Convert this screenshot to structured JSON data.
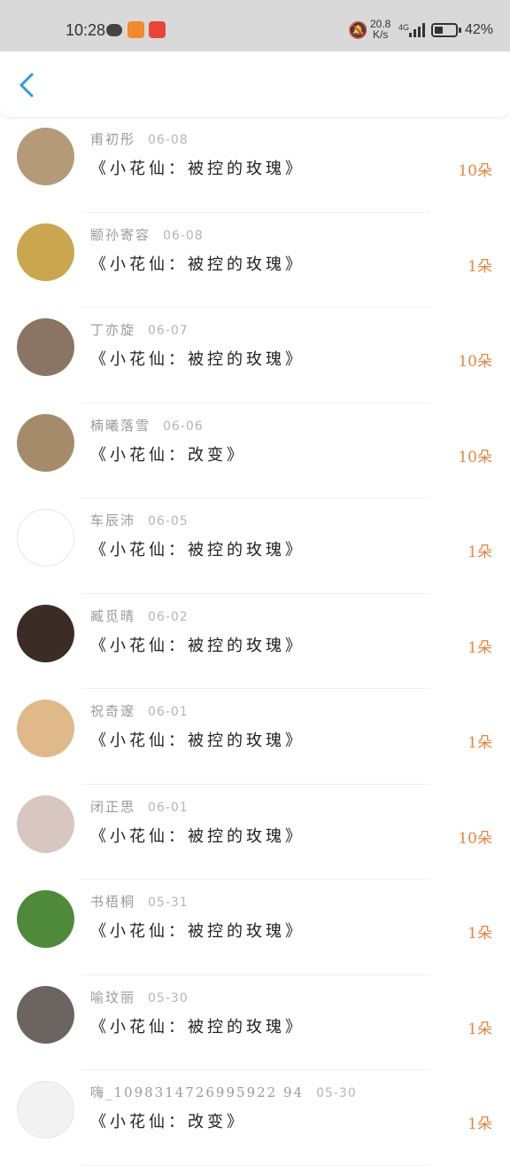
{
  "status_bar": {
    "time": "10:28",
    "speed_value": "20.8",
    "speed_unit": "K/s",
    "network": "4G",
    "battery_percent": "42%",
    "battery_level": 0.42
  },
  "header": {
    "back_icon": "chevron-left-icon",
    "accent_color": "#2b9be8"
  },
  "items": [
    {
      "name": "甫初彤",
      "date": "06-08",
      "title": "《小花仙：被控的玫瑰》",
      "count": "10朵",
      "avatar_color": "#b59a7a"
    },
    {
      "name": "颛孙寄容",
      "date": "06-08",
      "title": "《小花仙：被控的玫瑰》",
      "count": "1朵",
      "avatar_color": "#c9a64f"
    },
    {
      "name": "丁亦旋",
      "date": "06-07",
      "title": "《小花仙：被控的玫瑰》",
      "count": "10朵",
      "avatar_color": "#8a7565"
    },
    {
      "name": "楠曦落雪",
      "date": "06-06",
      "title": "《小花仙：改变》",
      "count": "10朵",
      "avatar_color": "#a58b6a"
    },
    {
      "name": "车辰沛",
      "date": "06-05",
      "title": "《小花仙：被控的玫瑰》",
      "count": "1朵",
      "avatar_color": "#ffffff"
    },
    {
      "name": "臧觅晴",
      "date": "06-02",
      "title": "《小花仙：被控的玫瑰》",
      "count": "1朵",
      "avatar_color": "#3b2d25"
    },
    {
      "name": "祝奇邃",
      "date": "06-01",
      "title": "《小花仙：被控的玫瑰》",
      "count": "1朵",
      "avatar_color": "#e0b98a"
    },
    {
      "name": "闭正思",
      "date": "06-01",
      "title": "《小花仙：被控的玫瑰》",
      "count": "10朵",
      "avatar_color": "#d8c6c0"
    },
    {
      "name": "书梧桐",
      "date": "05-31",
      "title": "《小花仙：被控的玫瑰》",
      "count": "1朵",
      "avatar_color": "#4e8a3a"
    },
    {
      "name": "喻玟丽",
      "date": "05-30",
      "title": "《小花仙：被控的玫瑰》",
      "count": "1朵",
      "avatar_color": "#6c6460"
    },
    {
      "name": "嗨_1098314726995922 94",
      "date": "05-30",
      "title": "《小花仙：改变》",
      "count": "1朵",
      "avatar_color": "#f2f2f2"
    }
  ]
}
